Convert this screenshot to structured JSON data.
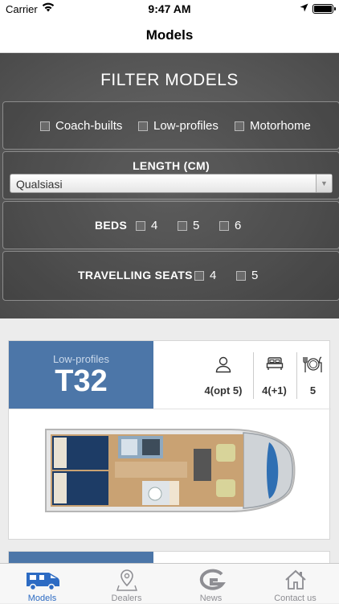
{
  "status": {
    "carrier": "Carrier",
    "time": "9:47 AM"
  },
  "nav": {
    "title": "Models"
  },
  "filter": {
    "title": "FILTER MODELS",
    "types": [
      "Coach-builts",
      "Low-profiles",
      "Motorhome"
    ],
    "length_label": "LENGTH (CM)",
    "length_value": "Qualsiasi",
    "beds_label": "BEDS",
    "beds_options": [
      "4",
      "5",
      "6"
    ],
    "seats_label": "TRAVELLING SEATS",
    "seats_options": [
      "4",
      "5"
    ]
  },
  "card": {
    "category": "Low-profiles",
    "model": "T32",
    "seats": "4(opt 5)",
    "beds": "4(+1)",
    "dining": "5",
    "icons": [
      "person-icon",
      "bed-icon",
      "dining-icon"
    ]
  },
  "tabs": [
    {
      "label": "Models",
      "icon": "camper-icon",
      "active": true
    },
    {
      "label": "Dealers",
      "icon": "location-pin-icon",
      "active": false
    },
    {
      "label": "News",
      "icon": "brand-g-icon",
      "active": false
    },
    {
      "label": "Contact us",
      "icon": "home-icon",
      "active": false
    }
  ],
  "colors": {
    "accent": "#4c76a8",
    "tab_active": "#2d6bc3",
    "tab_inactive": "#8e8e93"
  }
}
